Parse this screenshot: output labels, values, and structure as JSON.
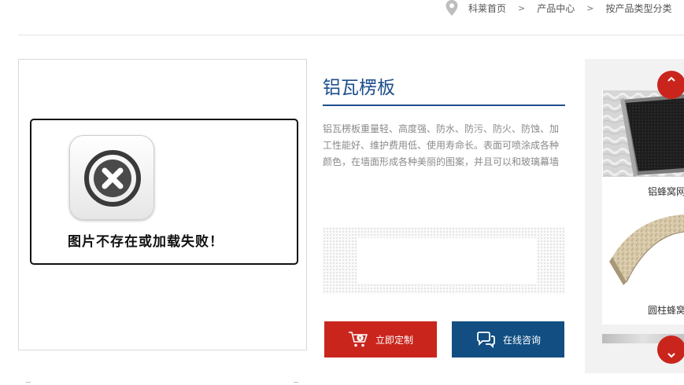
{
  "breadcrumb": {
    "items": [
      "科莱首页",
      "产品中心",
      "按产品类型分类"
    ],
    "separator": ">"
  },
  "image_area": {
    "error_text": "图片不存在或加载失败！"
  },
  "product": {
    "title": "铝瓦楞板",
    "description": "铝瓦楞板重量轻、高度强、防水、防污、防火、防蚀、加工性能好、维护费用低、使用寿命长。表面可喷涂成各种颜色，在墙面形成各种美丽的图案，并且可以和玻璃幕墙"
  },
  "buttons": {
    "customize_label": "立即定制",
    "consult_label": "在线咨询"
  },
  "sidebar": {
    "items": [
      {
        "label": "铝蜂窝网"
      },
      {
        "label": "圆柱蜂窝"
      }
    ]
  },
  "colors": {
    "brand_red": "#c9251d",
    "brand_blue": "#124e82",
    "title_blue": "#1e4f8c"
  }
}
